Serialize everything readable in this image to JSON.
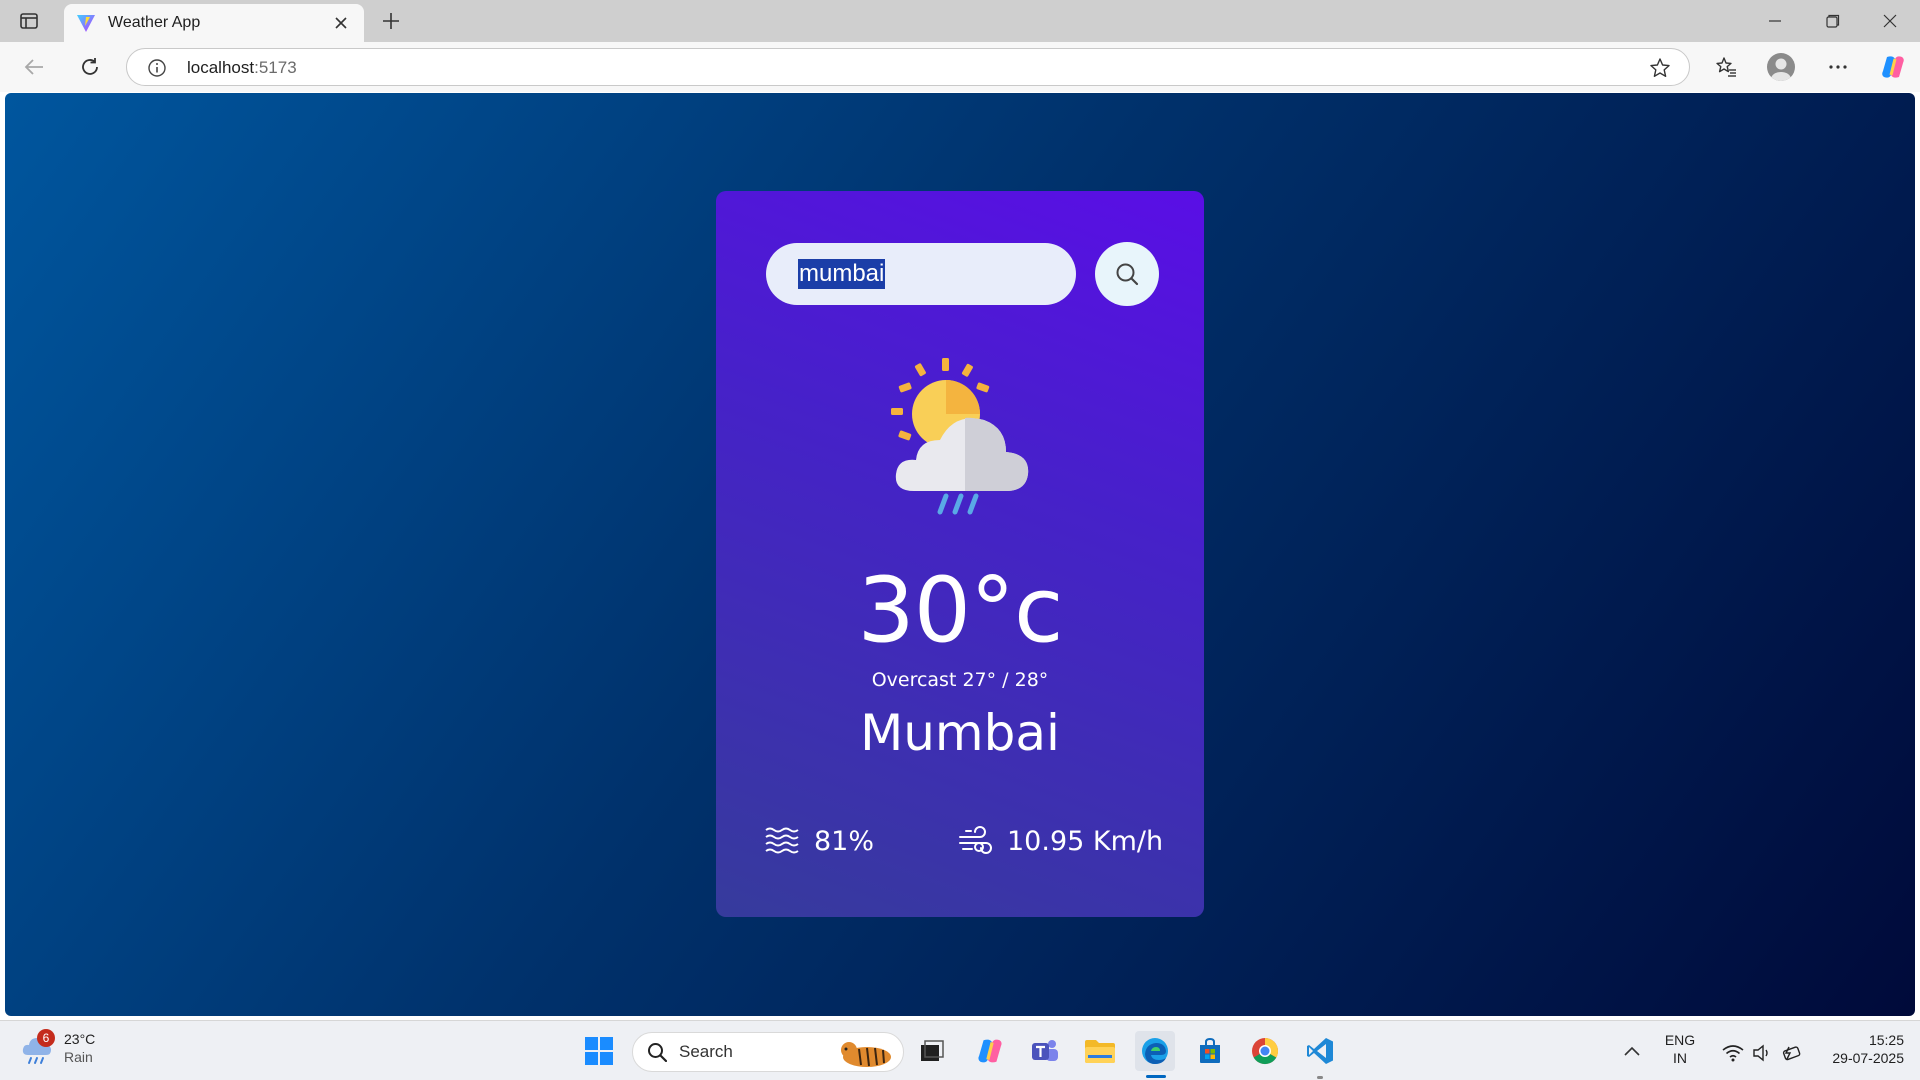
{
  "browser": {
    "tab_title": "Weather App",
    "url_host": "localhost",
    "url_port": ":5173"
  },
  "app": {
    "search_value": "mumbai",
    "temperature": "30°c",
    "description": "Overcast 27° / 28°",
    "city": "Mumbai",
    "humidity": "81%",
    "wind_speed": "10.95 Km/h",
    "weather_icon": "sun-cloud-rain-icon"
  },
  "taskbar": {
    "weather_temp": "23°C",
    "weather_desc": "Rain",
    "weather_badge": "6",
    "search_label": "Search",
    "lang_top": "ENG",
    "lang_bottom": "IN",
    "time": "15:25",
    "date": "29-07-2025"
  },
  "colors": {
    "card_top": "#5a0ee6",
    "card_bottom": "#363b9c",
    "bg_left": "#00569e",
    "bg_right": "#000a3a"
  }
}
